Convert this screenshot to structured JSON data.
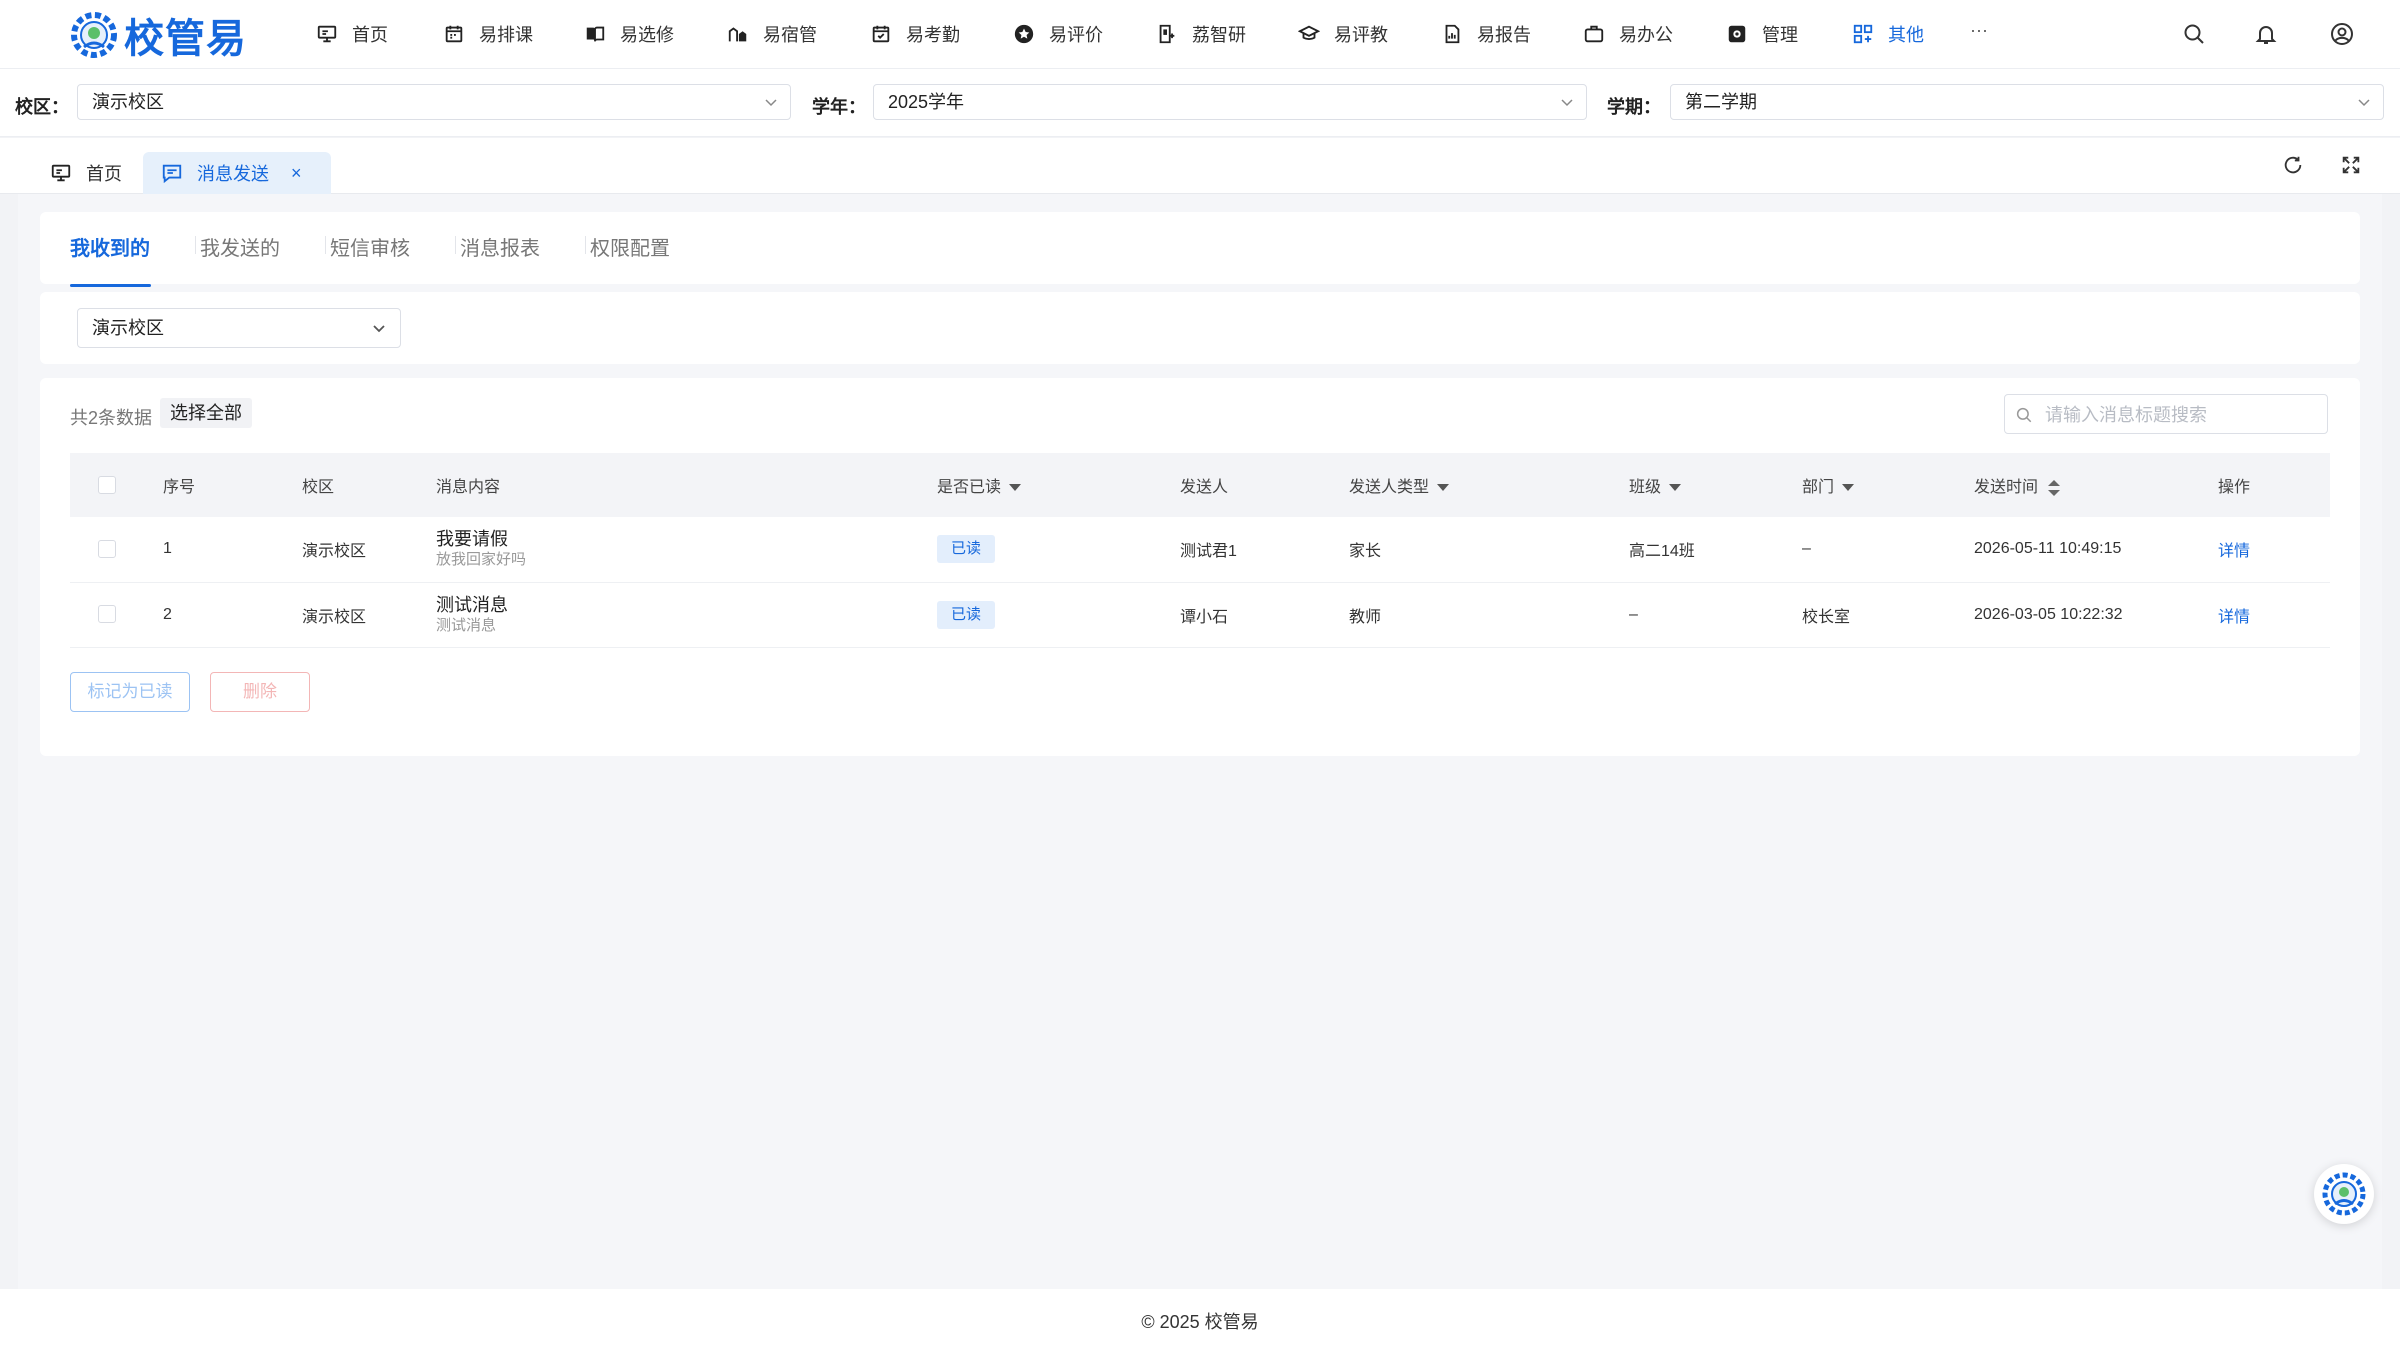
{
  "brand": {
    "name": "校管易",
    "accent": "#1668dc"
  },
  "nav": {
    "items": [
      {
        "label": "首页",
        "icon": "monitor-icon"
      },
      {
        "label": "易排课",
        "icon": "calendar-icon"
      },
      {
        "label": "易选修",
        "icon": "book-icon"
      },
      {
        "label": "易宿管",
        "icon": "dorm-icon"
      },
      {
        "label": "易考勤",
        "icon": "calendar-check-icon"
      },
      {
        "label": "易评价",
        "icon": "star-icon"
      },
      {
        "label": "荔智研",
        "icon": "research-icon"
      },
      {
        "label": "易评教",
        "icon": "graduation-cap-icon"
      },
      {
        "label": "易报告",
        "icon": "report-icon"
      },
      {
        "label": "易办公",
        "icon": "briefcase-icon"
      },
      {
        "label": "管理",
        "icon": "settings-icon"
      },
      {
        "label": "其他",
        "icon": "grid-plus-icon"
      }
    ],
    "more": "···"
  },
  "filters": {
    "campus_label": "校区：",
    "campus_value": "演示校区",
    "year_label": "学年：",
    "year_value": "2025学年",
    "term_label": "学期：",
    "term_value": "第二学期"
  },
  "page_tabs": [
    {
      "label": "首页"
    },
    {
      "label": "消息发送",
      "close": "×"
    }
  ],
  "sub_tabs": [
    "我收到的",
    "我发送的",
    "短信审核",
    "消息报表",
    "权限配置"
  ],
  "campus_filter": {
    "value": "演示校区"
  },
  "table": {
    "count_text": "共2条数据",
    "select_all": "选择全部",
    "search_placeholder": "请输入消息标题搜索",
    "columns": {
      "index": "序号",
      "campus": "校区",
      "content": "消息内容",
      "read": "是否已读",
      "sender": "发送人",
      "sender_type": "发送人类型",
      "class": "班级",
      "dept": "部门",
      "time": "发送时间",
      "action": "操作"
    },
    "rows": [
      {
        "index": "1",
        "campus": "演示校区",
        "title": "我要请假",
        "sub": "放我回家好吗",
        "read": "已读",
        "sender": "测试君1",
        "sender_type": "家长",
        "class": "高二14班",
        "dept": "–",
        "time": "2026-05-11 10:49:15",
        "action": "详情"
      },
      {
        "index": "2",
        "campus": "演示校区",
        "title": "测试消息",
        "sub": "测试消息",
        "read": "已读",
        "sender": "谭小石",
        "sender_type": "教师",
        "class": "–",
        "dept": "校长室",
        "time": "2026-03-05 10:22:32",
        "action": "详情"
      }
    ],
    "mark_read": "标记为已读",
    "delete": "删除"
  },
  "footer": "© 2025 校管易"
}
